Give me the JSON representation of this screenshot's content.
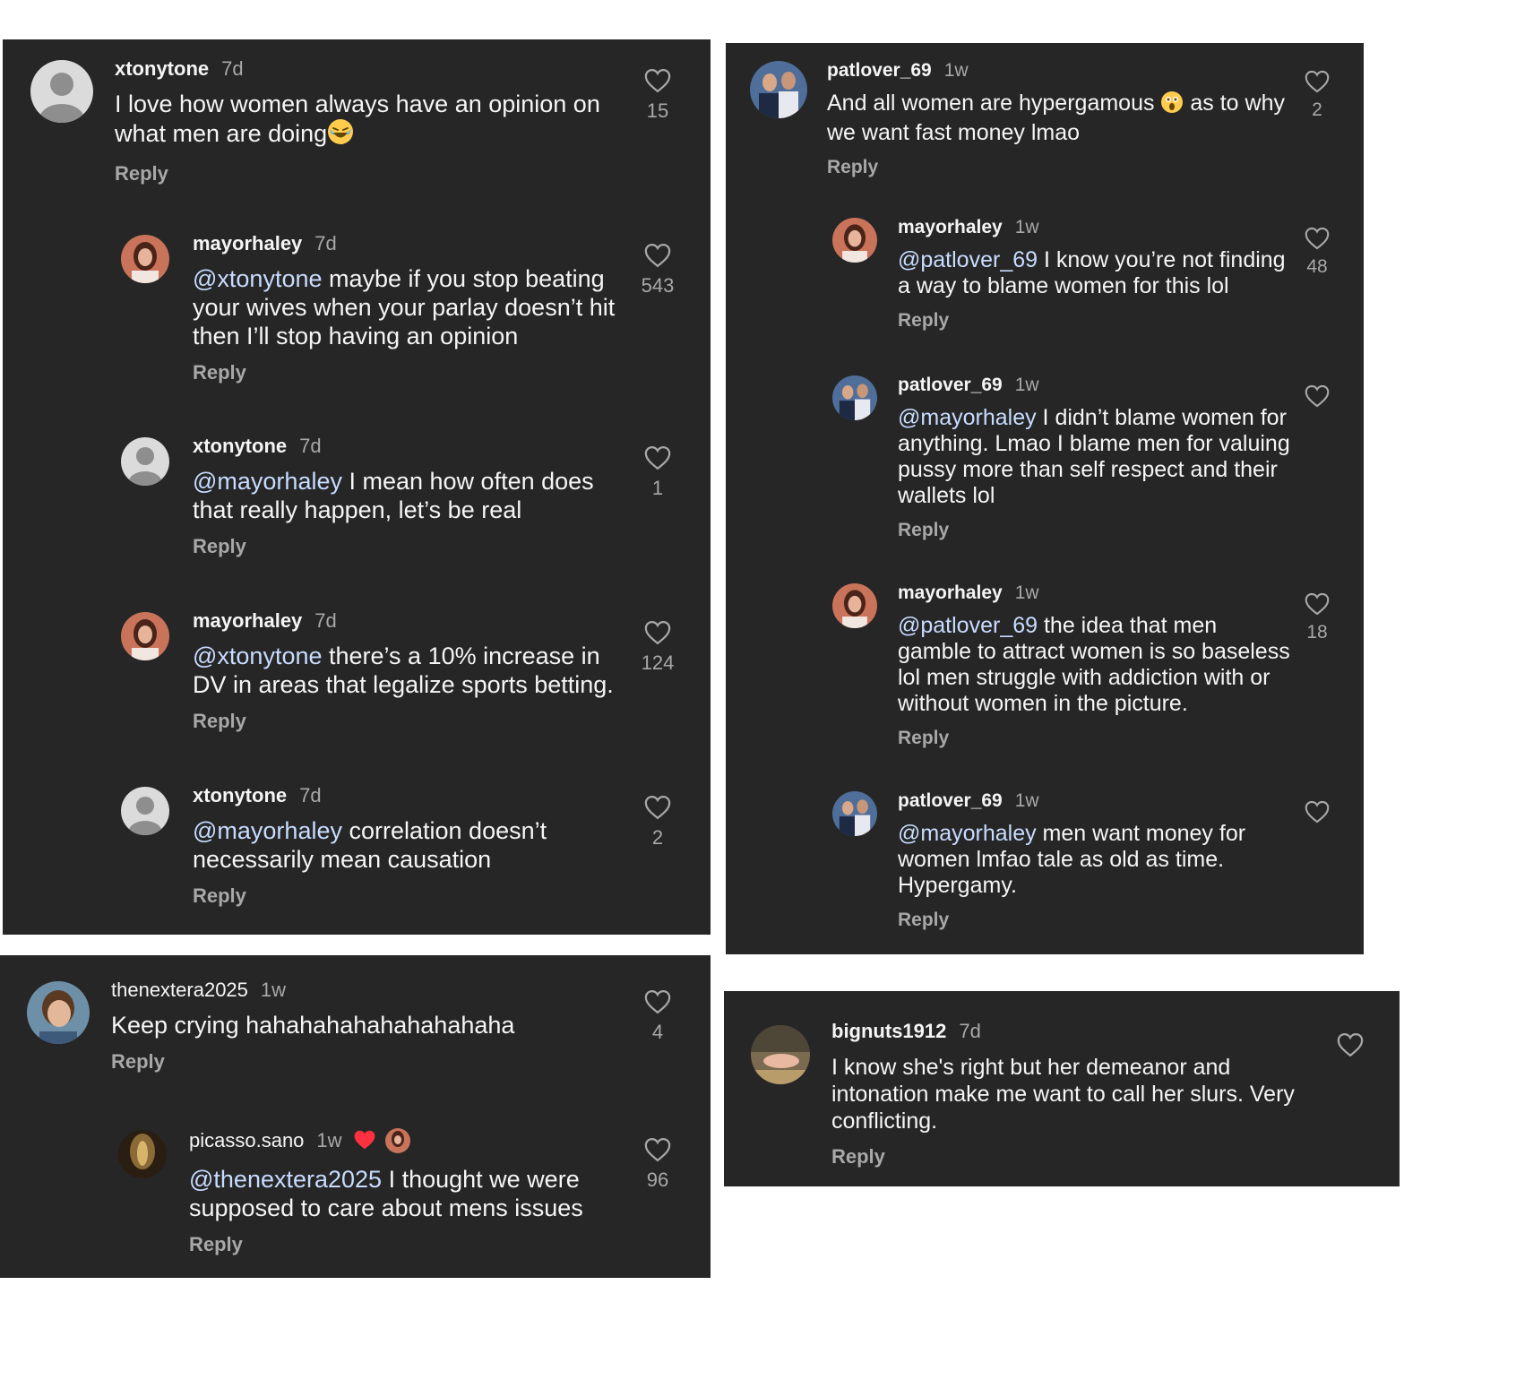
{
  "colors": {
    "panel_bg": "#262626",
    "text": "#f5f5f5",
    "muted": "#a8a8a8",
    "mention": "#c8dcff",
    "heart_red": "#ff3040"
  },
  "panels": [
    {
      "comments": [
        {
          "username": "xtonytone",
          "time": "7d",
          "avatar": "default-avatar",
          "mention": "",
          "text": "I love how women always have an opinion on what men are doing",
          "emoji": "laughing-emoji",
          "likes": "15",
          "reply": "Reply"
        },
        {
          "username": "mayorhaley",
          "time": "7d",
          "avatar": "photo-avatar",
          "mention": "@xtonytone",
          "text": " maybe if you stop beating your wives when your parlay doesn’t hit then I’ll stop having an opinion",
          "likes": "543",
          "reply": "Reply"
        },
        {
          "username": "xtonytone",
          "time": "7d",
          "avatar": "default-avatar",
          "mention": "@mayorhaley",
          "text": " I mean how often does that really happen, let’s be real",
          "likes": "1",
          "reply": "Reply"
        },
        {
          "username": "mayorhaley",
          "time": "7d",
          "avatar": "photo-avatar",
          "mention": "@xtonytone",
          "text": " there’s a 10% increase in DV in areas that legalize sports betting.",
          "likes": "124",
          "reply": "Reply"
        },
        {
          "username": "xtonytone",
          "time": "7d",
          "avatar": "default-avatar",
          "mention": "@mayorhaley",
          "text": " correlation doesn’t necessarily mean causation",
          "likes": "2",
          "reply": "Reply"
        }
      ]
    },
    {
      "comments": [
        {
          "username": "thenextera2025",
          "time": "1w",
          "avatar": "photo-avatar",
          "mention": "",
          "text": "Keep crying hahahahahahahahahaha",
          "likes": "4",
          "reply": "Reply"
        },
        {
          "username": "picasso.sano",
          "time": "1w",
          "avatar": "photo-avatar",
          "badge": "red-heart-icon",
          "mention": "@thenextera2025",
          "text": " I thought we were supposed to care about mens issues",
          "likes": "96",
          "reply": "Reply"
        }
      ]
    },
    {
      "comments": [
        {
          "username": "patlover_69",
          "time": "1w",
          "avatar": "photo-avatar",
          "mention": "",
          "text_before": "And all women are hypergamous ",
          "emoji": "astonished-emoji",
          "text": " as to why we want fast money lmao",
          "likes": "2",
          "reply": "Reply"
        },
        {
          "username": "mayorhaley",
          "time": "1w",
          "avatar": "photo-avatar",
          "mention": "@patlover_69",
          "text": " I know you’re not finding a way to blame women for this lol",
          "likes": "48",
          "reply": "Reply"
        },
        {
          "username": "patlover_69",
          "time": "1w",
          "avatar": "photo-avatar",
          "mention": "@mayorhaley",
          "text": " I didn’t blame women for anything. Lmao I blame men for valuing pussy more than self respect and their wallets lol",
          "likes": "",
          "reply": "Reply"
        },
        {
          "username": "mayorhaley",
          "time": "1w",
          "avatar": "photo-avatar",
          "mention": "@patlover_69",
          "text": " the idea that men gamble to attract women is so baseless lol men struggle with addiction with or without women in the picture.",
          "likes": "18",
          "reply": "Reply"
        },
        {
          "username": "patlover_69",
          "time": "1w",
          "avatar": "photo-avatar",
          "mention": "@mayorhaley",
          "text": " men want money for women lmfao tale as old as time. Hypergamy.",
          "likes": "",
          "reply": "Reply"
        }
      ]
    },
    {
      "comments": [
        {
          "username": "bignuts1912",
          "time": "7d",
          "avatar": "photo-avatar",
          "mention": "",
          "text": "I know she's right but her demeanor and intonation make me want to call her slurs. Very conflicting.",
          "likes": "",
          "reply": "Reply"
        }
      ]
    }
  ]
}
